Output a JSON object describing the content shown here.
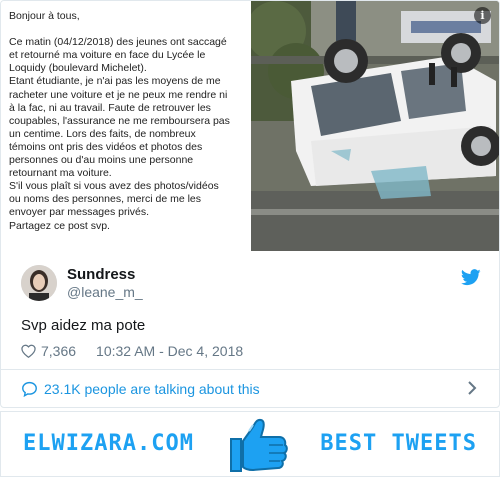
{
  "media": {
    "post_text": "Bonjour à tous,\n\nCe matin (04/12/2018) des jeunes ont saccagé\net retourné ma voiture en face du Lycée le\nLoquidy (boulevard Michelet).\nEtant étudiante, je n'ai pas les moyens de me\nracheter une voiture et je ne peux me rendre ni\nà la fac, ni au travail. Faute de retrouver les\ncoupables, l'assurance ne me remboursera pas\nun centime. Lors des faits, de nombreux\ntémoins ont pris des vidéos et photos des\npersonnes ou d'au moins une personne\nretournant ma voiture.\nS'il vous plaît si vous avez des photos/vidéos\nou noms des personnes, merci de me les\nenvoyer par messages privés.\nPartagez ce post svp.",
    "info_glyph": "i"
  },
  "tweet": {
    "display_name": "Sundress",
    "handle": "@leane_m_",
    "text": "Svp aidez ma pote",
    "likes": "7,366",
    "timestamp": "10:32 AM - Dec 4, 2018",
    "talking": "23.1K people are talking about this"
  },
  "footer": {
    "left_brand": "ELWIZARA.COM",
    "right_brand": "BEST TWEETS"
  },
  "colors": {
    "twitter_blue": "#1da1f2",
    "link_blue": "#1b95e0",
    "muted": "#657786"
  },
  "icons": {
    "twitter": "twitter-bird-icon",
    "like": "heart-icon",
    "reply": "chat-bubble-icon",
    "more": "chevron-right-icon",
    "info": "info-icon",
    "brand": "thumbs-up-icon"
  }
}
